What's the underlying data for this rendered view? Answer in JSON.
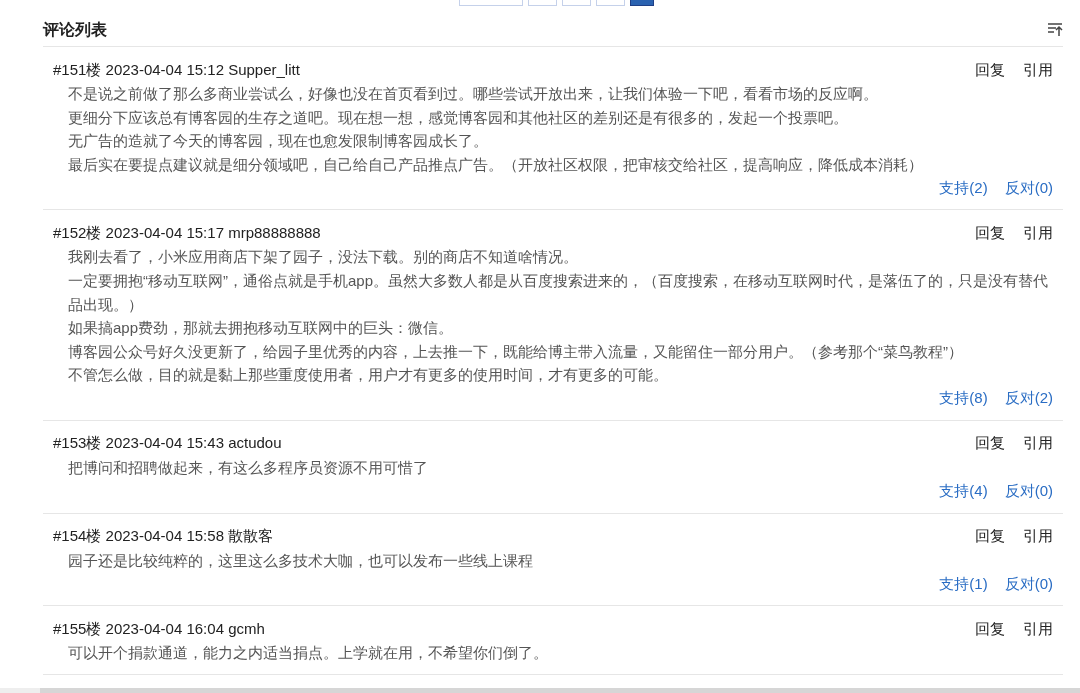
{
  "pagination": [
    {
      "selected": false
    },
    {
      "selected": false
    },
    {
      "selected": false
    },
    {
      "selected": false
    },
    {
      "selected": true
    }
  ],
  "section_title": "评论列表",
  "comments": [
    {
      "header": "#151楼 2023-04-04 15:12 Supper_litt",
      "reply": "回复",
      "quote": "引用",
      "body": [
        "不是说之前做了那么多商业尝试么，好像也没在首页看到过。哪些尝试开放出来，让我们体验一下吧，看看市场的反应啊。",
        "更细分下应该总有博客园的生存之道吧。现在想一想，感觉博客园和其他社区的差别还是有很多的，发起一个投票吧。",
        "无广告的造就了今天的博客园，现在也愈发限制博客园成长了。",
        "最后实在要提点建议就是细分领域吧，自己给自己产品推点广告。（开放社区权限，把审核交给社区，提高响应，降低成本消耗）"
      ],
      "support": "支持(2)",
      "oppose": "反对(0)"
    },
    {
      "header": "#152楼 2023-04-04 15:17 mrp88888888",
      "reply": "回复",
      "quote": "引用",
      "body": [
        "我刚去看了，小米应用商店下架了园子，没法下载。别的商店不知道啥情况。",
        "一定要拥抱“移动互联网”，通俗点就是手机app。虽然大多数人都是从百度搜索进来的，（百度搜索，在移动互联网时代，是落伍了的，只是没有替代品出现。）",
        "如果搞app费劲，那就去拥抱移动互联网中的巨头：微信。",
        "博客园公众号好久没更新了，给园子里优秀的内容，上去推一下，既能给博主带入流量，又能留住一部分用户。（参考那个“菜鸟教程”）",
        "不管怎么做，目的就是黏上那些重度使用者，用户才有更多的使用时间，才有更多的可能。"
      ],
      "support": "支持(8)",
      "oppose": "反对(2)"
    },
    {
      "header": "#153楼 2023-04-04 15:43 actudou",
      "reply": "回复",
      "quote": "引用",
      "body": [
        "把博问和招聘做起来，有这么多程序员资源不用可惜了"
      ],
      "support": "支持(4)",
      "oppose": "反对(0)"
    },
    {
      "header": "#154楼 2023-04-04 15:58 散散客",
      "reply": "回复",
      "quote": "引用",
      "body": [
        "园子还是比较纯粹的，这里这么多技术大咖，也可以发布一些线上课程"
      ],
      "support": "支持(1)",
      "oppose": "反对(0)"
    },
    {
      "header": "#155楼 2023-04-04 16:04 gcmh",
      "reply": "回复",
      "quote": "引用",
      "body": [
        "可以开个捐款通道，能力之内适当捐点。上学就在用，不希望你们倒了。"
      ]
    }
  ]
}
